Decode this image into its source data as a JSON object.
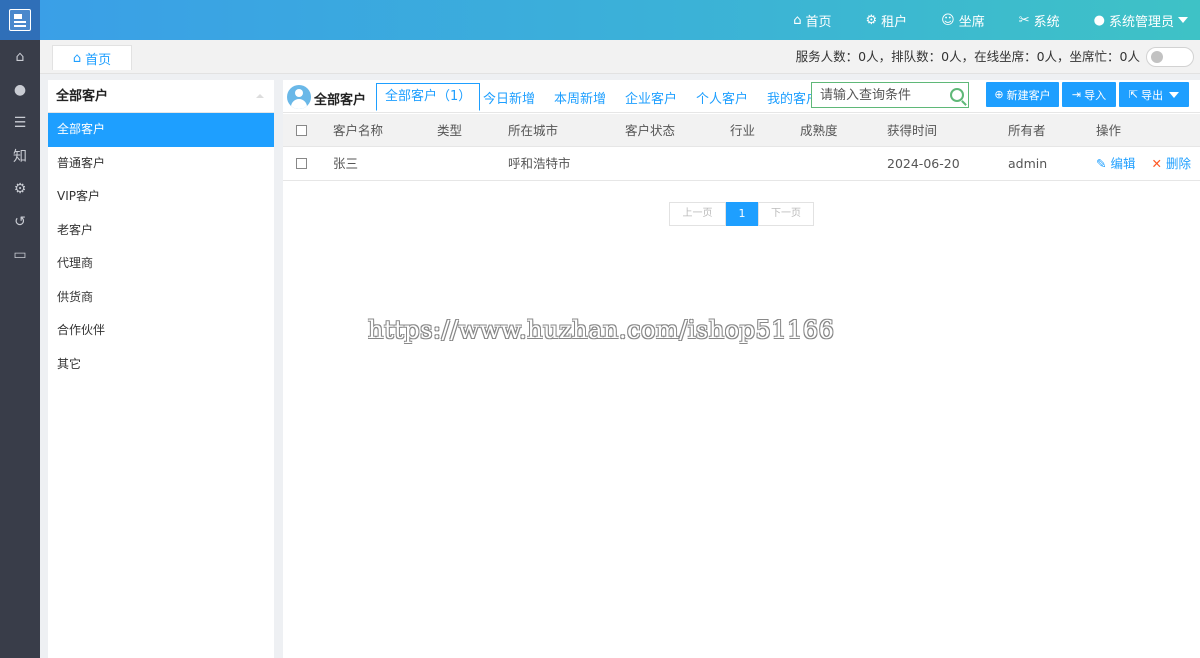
{
  "topbar": {
    "nav": [
      {
        "icon": "home-icon",
        "glyph": "⌂",
        "label": "首页"
      },
      {
        "icon": "gear-icon",
        "glyph": "⚙",
        "label": "租户"
      },
      {
        "icon": "user-outline-icon",
        "glyph": "☺",
        "label": "坐席"
      },
      {
        "icon": "tools-icon",
        "glyph": "✂",
        "label": "系统"
      }
    ],
    "user": {
      "icon": "user-icon",
      "glyph": "👤",
      "label": "系统管理员"
    }
  },
  "rail": [
    {
      "icon": "home-icon",
      "glyph": "⌂"
    },
    {
      "icon": "user-icon",
      "glyph": "●"
    },
    {
      "icon": "contacts-icon",
      "glyph": "☰"
    },
    {
      "icon": "knowledge-icon",
      "glyph": "知"
    },
    {
      "icon": "settings-icon",
      "glyph": "⚙"
    },
    {
      "icon": "history-icon",
      "glyph": "↺"
    },
    {
      "icon": "monitor-icon",
      "glyph": "▭"
    }
  ],
  "tabstrip": {
    "home_tab": {
      "glyph": "⌂",
      "label": "首页"
    },
    "stats": "服务人数：0人，排队数：0人，在线坐席：0人，坐席忙：0人"
  },
  "categories": {
    "title": "全部客户",
    "items": [
      "全部客户",
      "普通客户",
      "VIP客户",
      "老客户",
      "代理商",
      "供货商",
      "合作伙伴",
      "其它"
    ],
    "active_index": 0
  },
  "main": {
    "title": "全部客户",
    "tabs": [
      "全部客户（1）",
      "今日新增",
      "本周新增",
      "企业客户",
      "个人客户",
      "我的客户"
    ],
    "search": {
      "placeholder": "请输入查询条件",
      "value": ""
    },
    "buttons": {
      "new": {
        "glyph": "⊕",
        "label": "新建客户"
      },
      "import": {
        "glyph": "⇥",
        "label": "导入"
      },
      "export": {
        "glyph": "⇱",
        "label": "导出"
      }
    },
    "table": {
      "columns": [
        "客户名称",
        "类型",
        "所在城市",
        "客户状态",
        "行业",
        "成熟度",
        "获得时间",
        "所有者",
        "操作"
      ],
      "rows": [
        {
          "name": "张三",
          "type": "",
          "city": "呼和浩特市",
          "status": "",
          "industry": "",
          "maturity": "",
          "time": "2024-06-20",
          "owner": "admin",
          "edit": "编辑",
          "delete": "删除"
        }
      ]
    },
    "pagination": {
      "prev": "上一页",
      "current": "1",
      "next": "下一页"
    }
  },
  "watermark": "https://www.huzhan.com/ishop51166",
  "colors": {
    "accent": "#1e9fff",
    "rail": "#393d49",
    "search_border": "#5fb878",
    "danger": "#ff5722"
  }
}
